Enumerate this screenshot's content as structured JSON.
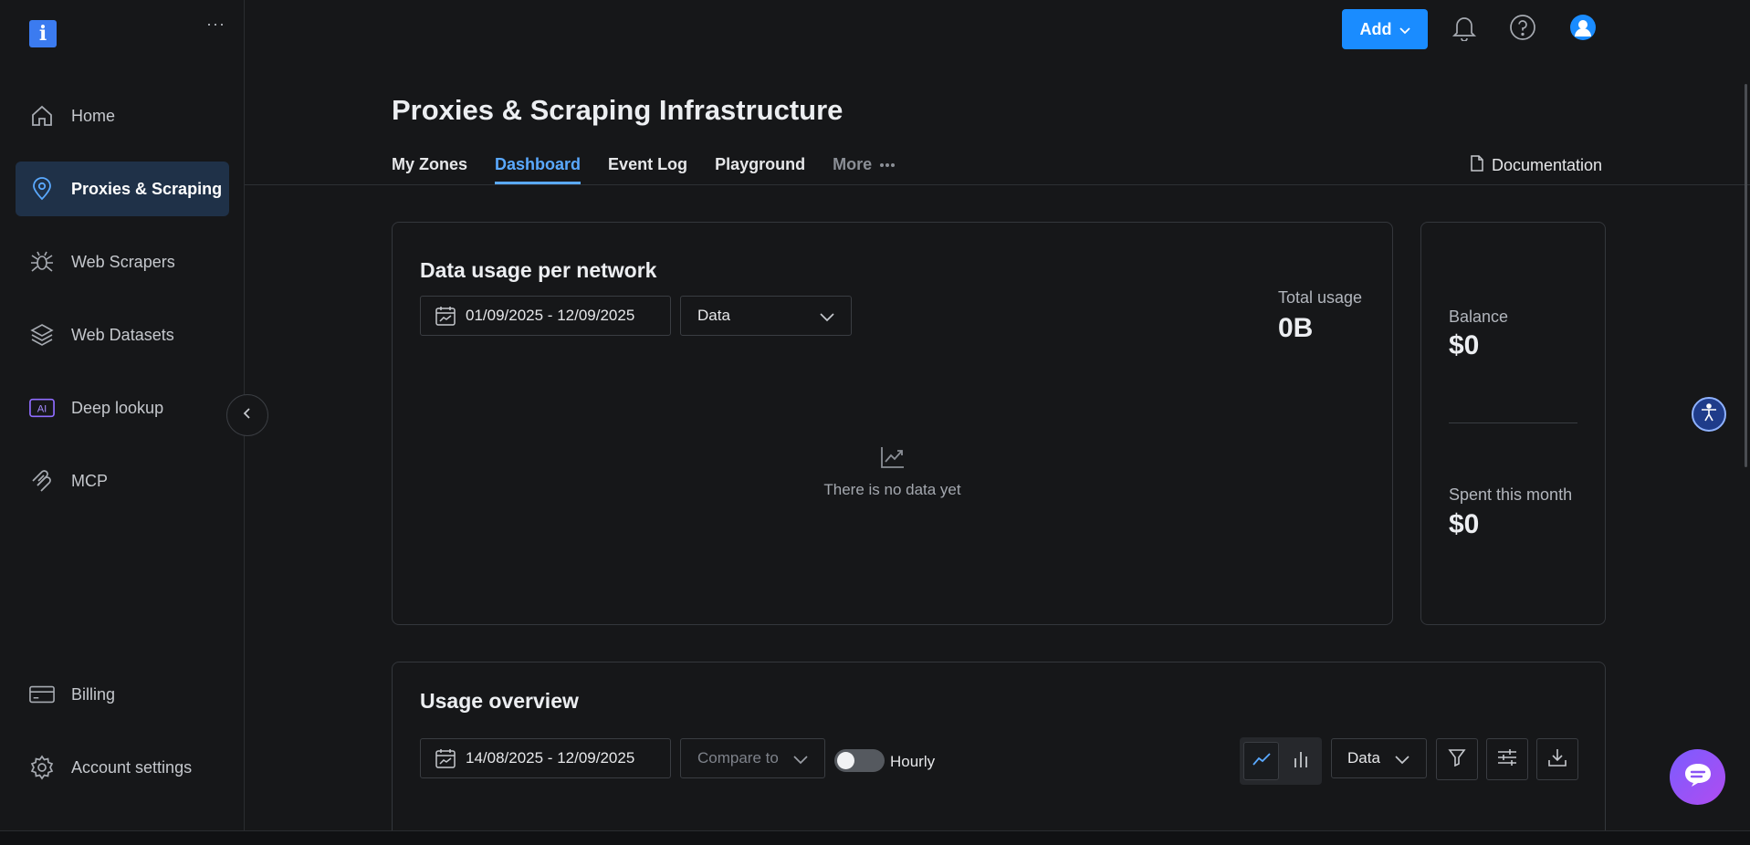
{
  "sidebar": {
    "more_label": "···",
    "items": [
      {
        "label": "Home",
        "icon": "home-icon"
      },
      {
        "label": "Proxies & Scraping",
        "icon": "location-pin-icon",
        "active": true
      },
      {
        "label": "Web Scrapers",
        "icon": "spider-icon"
      },
      {
        "label": "Web Datasets",
        "icon": "layers-icon"
      },
      {
        "label": "Deep lookup",
        "icon": "ai-icon",
        "badge": "AI"
      },
      {
        "label": "MCP",
        "icon": "mcp-icon"
      },
      {
        "label": "Billing",
        "icon": "credit-card-icon"
      },
      {
        "label": "Account settings",
        "icon": "gear-icon"
      }
    ]
  },
  "topbar": {
    "add_label": "Add"
  },
  "header": {
    "title": "Proxies & Scraping Infrastructure",
    "tabs": [
      "My Zones",
      "Dashboard",
      "Event Log",
      "Playground",
      "More"
    ],
    "active_tab": "Dashboard",
    "documentation_label": "Documentation"
  },
  "data_usage": {
    "title": "Data usage per network",
    "date_range": "01/09/2025 - 12/09/2025",
    "metric_select": "Data",
    "total_label": "Total usage",
    "total_value": "0B",
    "empty_message": "There is no data yet"
  },
  "balance_card": {
    "balance_label": "Balance",
    "balance_value": "$0",
    "spent_label": "Spent this month",
    "spent_value": "$0"
  },
  "usage_overview": {
    "title": "Usage overview",
    "date_range": "14/08/2025 - 12/09/2025",
    "compare_placeholder": "Compare to",
    "hourly_label": "Hourly",
    "hourly_enabled": false,
    "metric_select": "Data",
    "chart_mode": "line"
  },
  "colors": {
    "accent": "#1a8cff",
    "active_tab": "#5aa9ff",
    "background": "#161719"
  }
}
